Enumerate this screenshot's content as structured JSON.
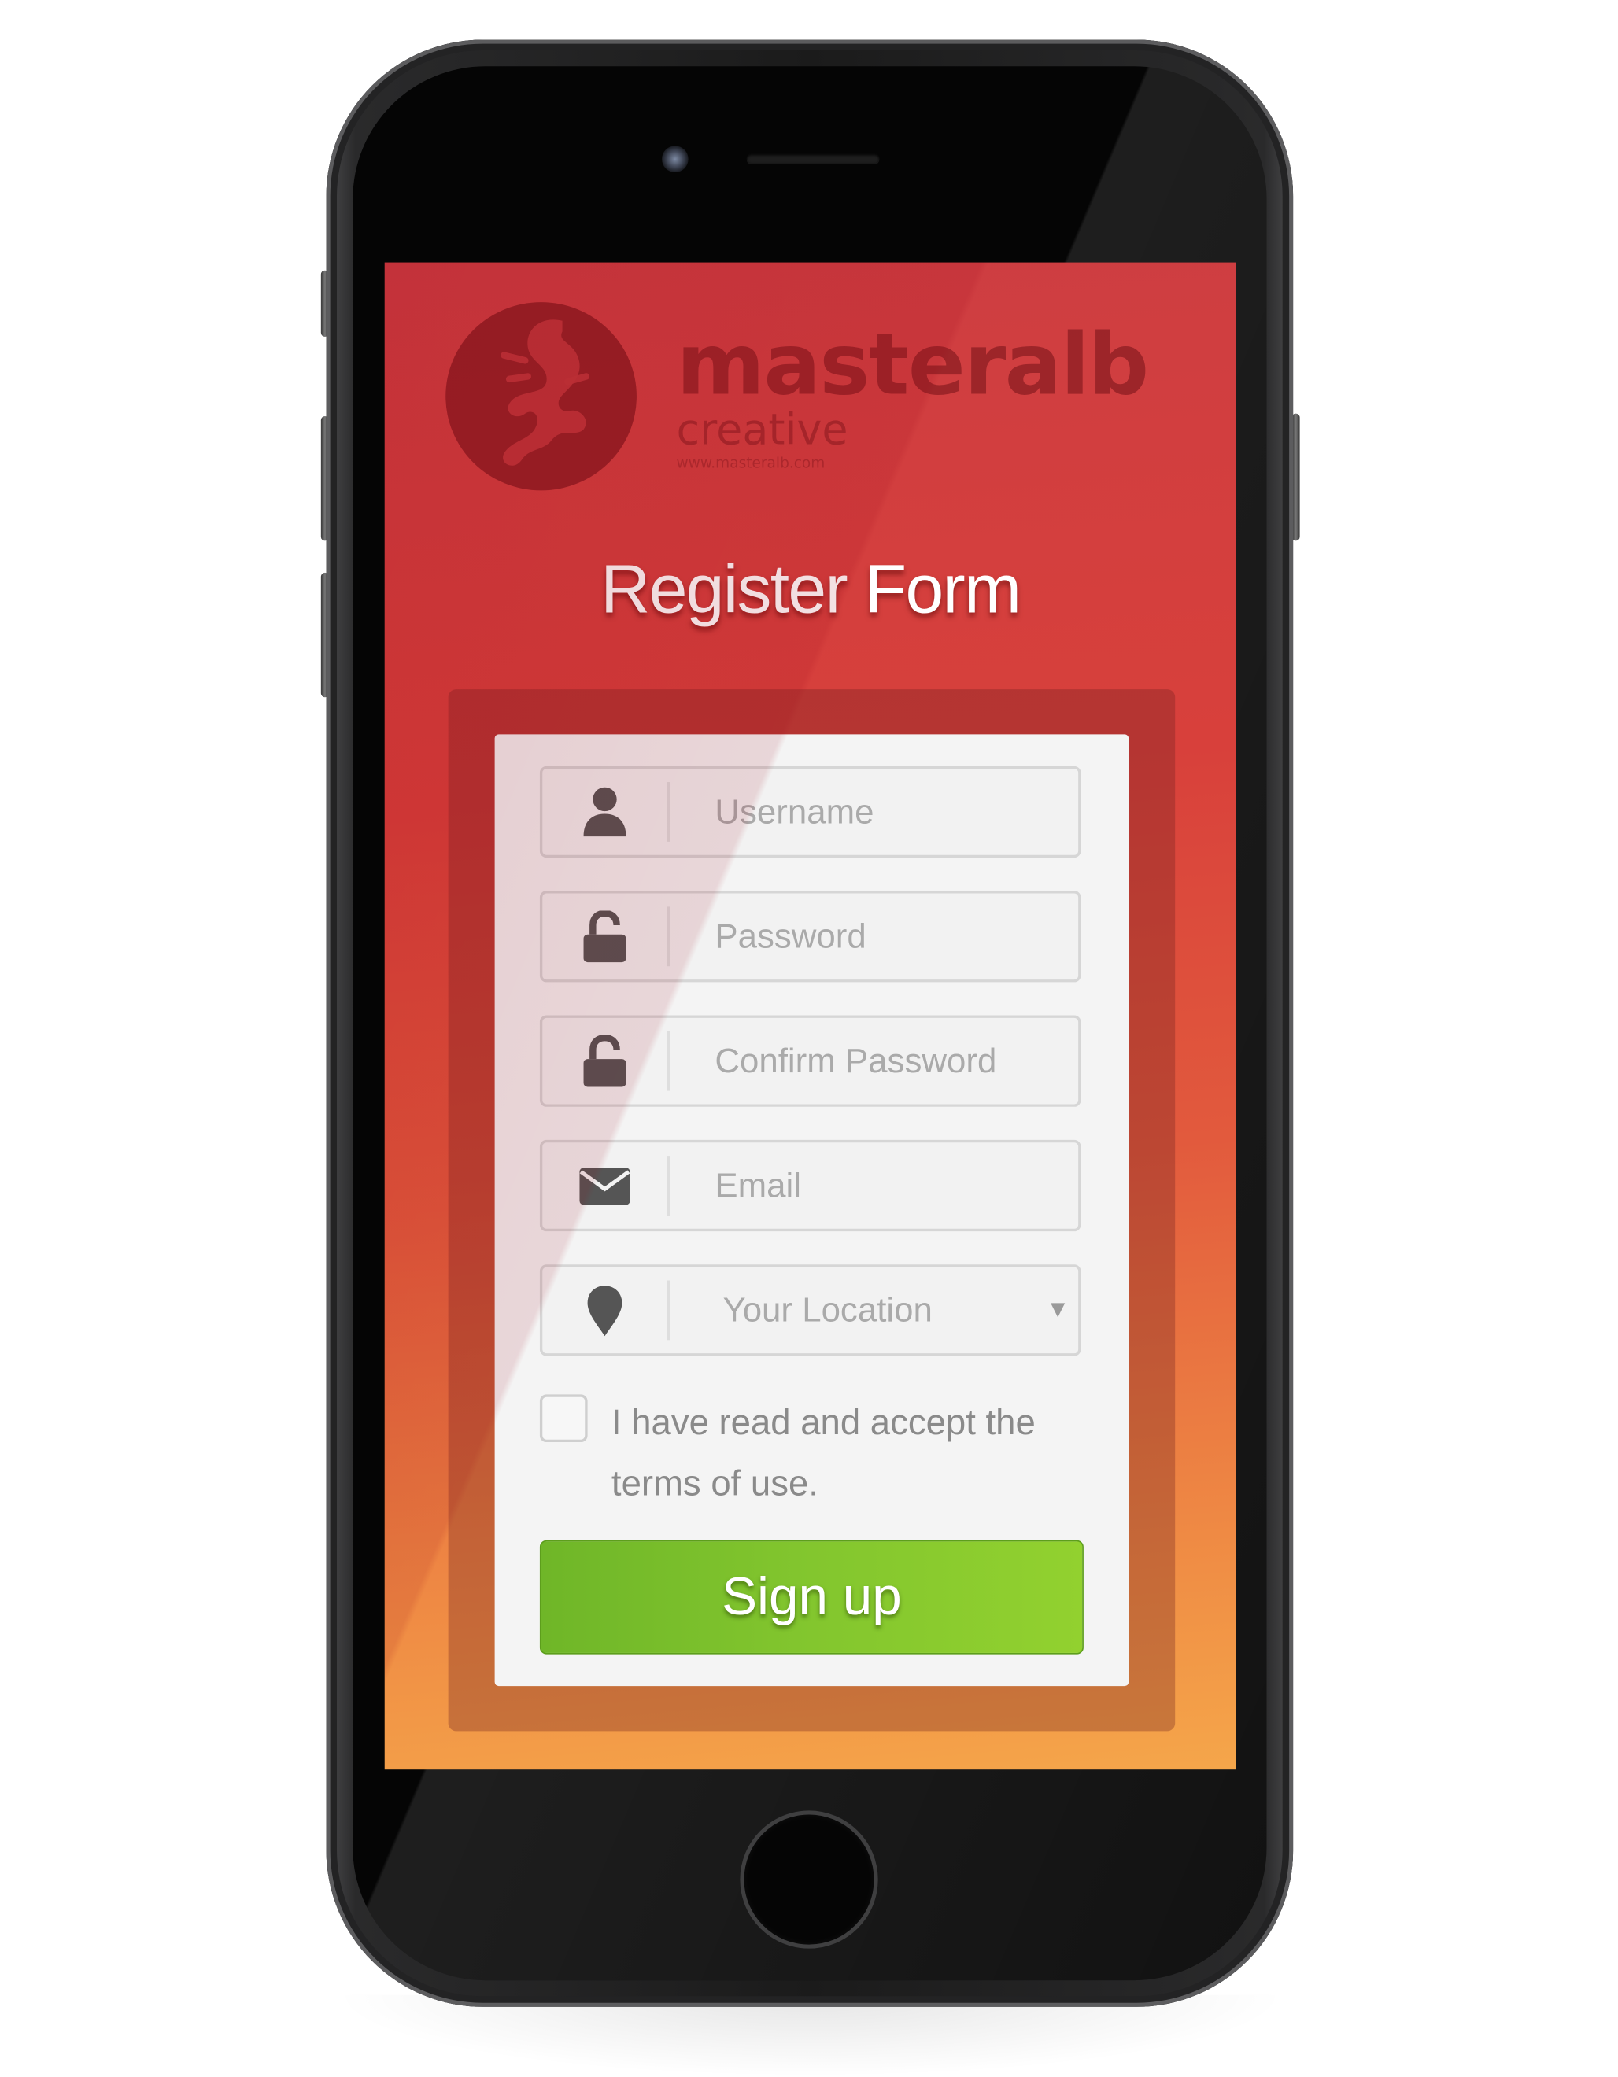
{
  "brand": {
    "name": "masteralb",
    "tagline": "creative",
    "url": "www.masteralb.com"
  },
  "form": {
    "title": "Register Form",
    "fields": {
      "username": {
        "placeholder": "Username",
        "icon": "user-icon"
      },
      "password": {
        "placeholder": "Password",
        "icon": "lock-icon"
      },
      "confirm_password": {
        "placeholder": "Confirm Password",
        "icon": "lock-icon"
      },
      "email": {
        "placeholder": "Email",
        "icon": "envelope-icon"
      },
      "location": {
        "selected": "Your Location",
        "icon": "map-pin-icon",
        "caret": "▼"
      }
    },
    "terms": {
      "checked": false,
      "label": "I have read and accept the terms of use."
    },
    "submit_label": "Sign up"
  },
  "colors": {
    "screen_top": "#cd3d42",
    "screen_bottom": "#f5a64a",
    "button": "#83c62e",
    "card": "#f4f4f4",
    "icon": "#555555"
  }
}
